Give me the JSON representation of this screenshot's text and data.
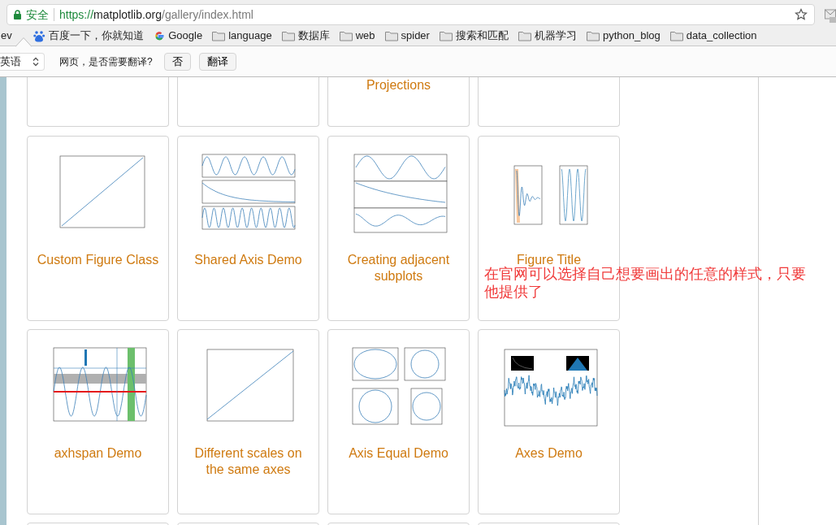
{
  "browser": {
    "security_label": "安全",
    "url": {
      "scheme": "https://",
      "host": "matplotlib.org",
      "path": "/gallery/index.html"
    }
  },
  "bookmarks": [
    {
      "label": "ev",
      "kind": "plain"
    },
    {
      "label": "百度一下，你就知道",
      "kind": "paw"
    },
    {
      "label": "Google",
      "kind": "google"
    },
    {
      "label": "language",
      "kind": "folder"
    },
    {
      "label": "数据库",
      "kind": "folder"
    },
    {
      "label": "web",
      "kind": "folder"
    },
    {
      "label": "spider",
      "kind": "folder"
    },
    {
      "label": "搜索和匹配",
      "kind": "folder"
    },
    {
      "label": "机器学习",
      "kind": "folder"
    },
    {
      "label": "python_blog",
      "kind": "folder"
    },
    {
      "label": "data_collection",
      "kind": "folder"
    }
  ],
  "translate_bar": {
    "language": "英语",
    "prompt": "网页，是否需要翻译?",
    "buttons": [
      "否",
      "翻译"
    ]
  },
  "gallery": {
    "rows": [
      {
        "cards": [
          {
            "kind": "cuttop"
          },
          {
            "kind": "cuttop"
          },
          {
            "kind": "cuttop",
            "title": "Projections"
          },
          {
            "kind": "cuttop"
          }
        ]
      },
      {
        "cards": [
          {
            "title": "Custom Figure Class",
            "kind": "line"
          },
          {
            "title": "Shared Axis Demo",
            "kind": "shared"
          },
          {
            "title": "Creating adjacent subplots",
            "kind": "adjacent"
          },
          {
            "title": "Figure Title",
            "kind": "figtitle"
          }
        ]
      },
      {
        "cards": [
          {
            "title": "axhspan Demo",
            "kind": "axhspan"
          },
          {
            "title": "Different scales on the same axes",
            "kind": "twin"
          },
          {
            "title": "Axis Equal Demo",
            "kind": "equal"
          },
          {
            "title": "Axes Demo",
            "kind": "noise"
          }
        ]
      },
      {
        "cards": [
          {
            "kind": "cutbottom"
          },
          {
            "kind": "cutbottom"
          },
          {
            "kind": "cutbottom"
          },
          {
            "kind": "cutbottom"
          }
        ]
      }
    ]
  },
  "annotation": {
    "text": "在官网可以选择自己想要画出的任意的样式，只要他提供了"
  }
}
